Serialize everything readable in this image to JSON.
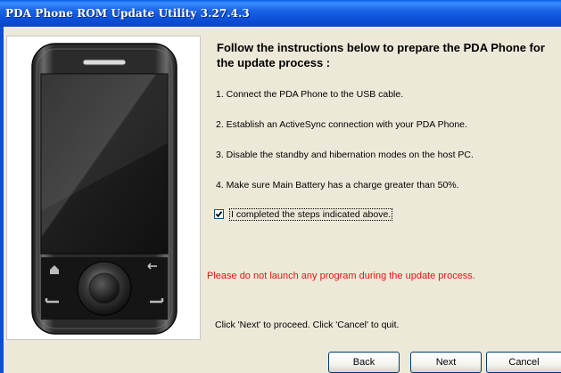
{
  "window": {
    "title": "PDA Phone ROM Update Utility 3.27.4.3"
  },
  "instructions": {
    "heading": "Follow the instructions below to prepare the PDA Phone for the update process :",
    "steps": [
      "1. Connect the PDA Phone to the USB cable.",
      "2. Establish an ActiveSync connection with your PDA Phone.",
      "3. Disable the standby and hibernation modes on the host PC.",
      "4. Make sure Main Battery has a charge greater than 50%."
    ]
  },
  "confirm_checkbox": {
    "label": "I completed the steps indicated above.",
    "checked": true
  },
  "warning": {
    "text": "Please do not launch any program during the update process.",
    "color": "#e81212"
  },
  "hint": "Click 'Next' to proceed. Click 'Cancel' to quit.",
  "buttons": {
    "back": "Back",
    "next": "Next",
    "cancel": "Cancel"
  },
  "colors": {
    "titlebar": "#0b4fd6",
    "window_bg": "#ece9d8"
  },
  "phone_image": {
    "alt": "pda-phone-device"
  }
}
